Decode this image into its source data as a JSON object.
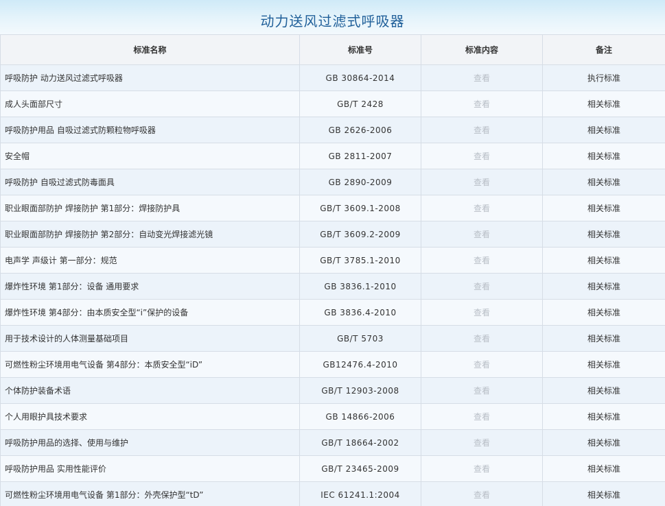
{
  "page_title": "动力送风过滤式呼吸器",
  "table": {
    "headers": [
      "标准名称",
      "标准号",
      "标准内容",
      "备注"
    ],
    "rows": [
      {
        "name": "呼吸防护 动力送风过滤式呼吸器",
        "code": "GB 30864-2014",
        "view": "查看",
        "note": "执行标准"
      },
      {
        "name": "成人头面部尺寸",
        "code": "GB/T 2428",
        "view": "查看",
        "note": "相关标准"
      },
      {
        "name": "呼吸防护用品 自吸过滤式防颗粒物呼吸器",
        "code": "GB 2626-2006",
        "view": "查看",
        "note": "相关标准"
      },
      {
        "name": "安全帽",
        "code": "GB 2811-2007",
        "view": "查看",
        "note": "相关标准"
      },
      {
        "name": "呼吸防护 自吸过滤式防毒面具",
        "code": "GB 2890-2009",
        "view": "查看",
        "note": "相关标准"
      },
      {
        "name": "职业眼面部防护 焊接防护 第1部分：焊接防护具",
        "code": "GB/T 3609.1-2008",
        "view": "查看",
        "note": "相关标准"
      },
      {
        "name": "职业眼面部防护 焊接防护 第2部分：自动变光焊接滤光镜",
        "code": "GB/T 3609.2-2009",
        "view": "查看",
        "note": "相关标准"
      },
      {
        "name": "电声学 声级计 第一部分：规范",
        "code": "GB/T 3785.1-2010",
        "view": "查看",
        "note": "相关标准"
      },
      {
        "name": "爆炸性环境 第1部分：设备 通用要求",
        "code": "GB 3836.1-2010",
        "view": "查看",
        "note": "相关标准"
      },
      {
        "name": "爆炸性环境 第4部分：由本质安全型“i”保护的设备",
        "code": "GB 3836.4-2010",
        "view": "查看",
        "note": "相关标准"
      },
      {
        "name": "用于技术设计的人体测量基础项目",
        "code": "GB/T 5703",
        "view": "查看",
        "note": "相关标准"
      },
      {
        "name": "可燃性粉尘环境用电气设备 第4部分：本质安全型“iD”",
        "code": "GB12476.4-2010",
        "view": "查看",
        "note": "相关标准"
      },
      {
        "name": "个体防护装备术语",
        "code": "GB/T 12903-2008",
        "view": "查看",
        "note": "相关标准"
      },
      {
        "name": "个人用眼护具技术要求",
        "code": "GB 14866-2006",
        "view": "查看",
        "note": "相关标准"
      },
      {
        "name": "呼吸防护用品的选择、使用与维护",
        "code": "GB/T 18664-2002",
        "view": "查看",
        "note": "相关标准"
      },
      {
        "name": "呼吸防护用品 实用性能评价",
        "code": "GB/T 23465-2009",
        "view": "查看",
        "note": "相关标准"
      },
      {
        "name": "可燃性粉尘环境用电气设备 第1部分：外壳保护型“tD”",
        "code": "IEC 61241.1:2004",
        "view": "查看",
        "note": "相关标准"
      }
    ]
  }
}
